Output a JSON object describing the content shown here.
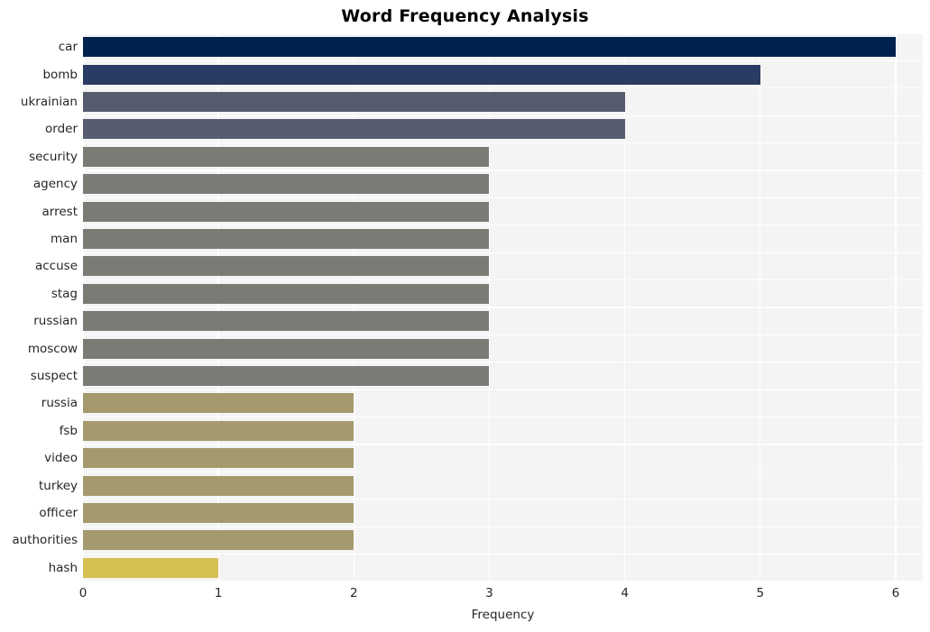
{
  "chart_data": {
    "type": "bar",
    "orientation": "horizontal",
    "title": "Word Frequency Analysis",
    "xlabel": "Frequency",
    "ylabel": "",
    "xlim": [
      0,
      6.2
    ],
    "xticks": [
      "0",
      "1",
      "2",
      "3",
      "4",
      "5",
      "6"
    ],
    "xtick_values": [
      0,
      1,
      2,
      3,
      4,
      5,
      6
    ],
    "grid": true,
    "legend": "none",
    "background": "#f4f4f4",
    "gridline_color": "#ffffff",
    "categories": [
      "car",
      "bomb",
      "ukrainian",
      "order",
      "security",
      "agency",
      "arrest",
      "man",
      "accuse",
      "stag",
      "russian",
      "moscow",
      "suspect",
      "russia",
      "fsb",
      "video",
      "turkey",
      "officer",
      "authorities",
      "hash"
    ],
    "values": [
      6,
      5,
      4,
      4,
      3,
      3,
      3,
      3,
      3,
      3,
      3,
      3,
      3,
      2,
      2,
      2,
      2,
      2,
      2,
      1
    ],
    "bar_colors": [
      "#00224e",
      "#2b3c६4",
      "#575b6e",
      "#575d70",
      "#7b7a75",
      "#7b7a75",
      "#7b7a75",
      "#7b7a75",
      "#7b7a75",
      "#7b7a75",
      "#7b7a75",
      "#7b7a75",
      "#7b7a75",
      "#a49a6e",
      "#a49a6e",
      "#a49a6e",
      "#a49a6e",
      "#a49a6e",
      "#a49a6e",
      "#d4c152"
    ],
    "colormap": "cividis"
  }
}
